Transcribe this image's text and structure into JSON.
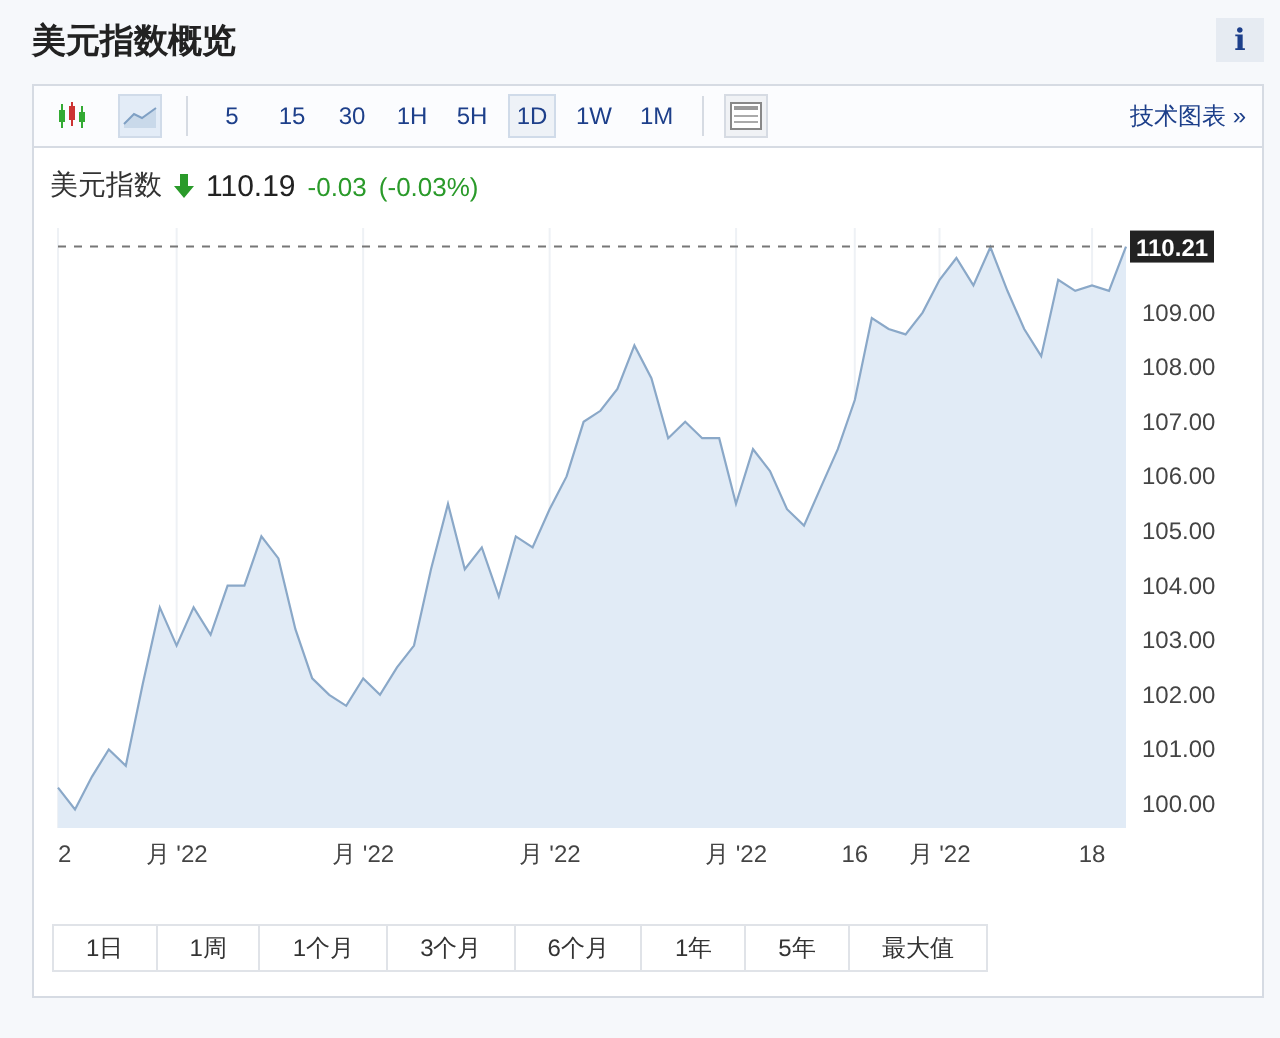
{
  "title": "美元指数概览",
  "info_button": "i",
  "toolbar": {
    "chart_types": [
      {
        "kind": "candlestick",
        "selected": false
      },
      {
        "kind": "area",
        "selected": true
      }
    ],
    "intervals": [
      {
        "label": "5",
        "selected": false
      },
      {
        "label": "15",
        "selected": false
      },
      {
        "label": "30",
        "selected": false
      },
      {
        "label": "1H",
        "selected": false
      },
      {
        "label": "5H",
        "selected": false
      },
      {
        "label": "1D",
        "selected": true
      },
      {
        "label": "1W",
        "selected": false
      },
      {
        "label": "1M",
        "selected": false
      }
    ],
    "technical_link": "技术图表 »"
  },
  "quote": {
    "name": "美元指数",
    "price": "110.19",
    "change": "-0.03",
    "change_percent": "(-0.03%)"
  },
  "chart_data": {
    "type": "area",
    "grid": true,
    "ylim": [
      99.56,
      110.55
    ],
    "categories": [
      "2",
      null,
      null,
      null,
      null,
      null,
      null,
      "月 '22",
      null,
      null,
      null,
      null,
      null,
      null,
      null,
      null,
      null,
      null,
      "月 '22",
      null,
      null,
      null,
      null,
      null,
      null,
      null,
      null,
      null,
      null,
      "月 '22",
      null,
      null,
      null,
      null,
      null,
      null,
      null,
      null,
      null,
      null,
      "月 '22",
      null,
      null,
      null,
      null,
      null,
      null,
      "16",
      null,
      null,
      null,
      null,
      "月 '22",
      null,
      null,
      null,
      null,
      null,
      null,
      null,
      null,
      "18",
      null,
      null
    ],
    "yticks": [
      {
        "value": 100,
        "label": "100.00"
      },
      {
        "value": 101,
        "label": "101.00"
      },
      {
        "value": 102,
        "label": "102.00"
      },
      {
        "value": 103,
        "label": "103.00"
      },
      {
        "value": 104,
        "label": "104.00"
      },
      {
        "value": 105,
        "label": "105.00"
      },
      {
        "value": 106,
        "label": "106.00"
      },
      {
        "value": 107,
        "label": "107.00"
      },
      {
        "value": 108,
        "label": "108.00"
      },
      {
        "value": 109,
        "label": "109.00"
      }
    ],
    "series": [
      {
        "color": "#8aa8c8",
        "values": [
          100.3,
          99.9,
          100.5,
          101.0,
          100.7,
          102.2,
          103.6,
          102.9,
          103.6,
          103.1,
          104.0,
          104.0,
          104.9,
          104.5,
          103.2,
          102.3,
          102.0,
          101.8,
          102.3,
          102.0,
          102.5,
          102.9,
          104.3,
          105.5,
          104.3,
          104.7,
          103.8,
          104.9,
          104.7,
          105.4,
          106.0,
          107.0,
          107.2,
          107.6,
          108.4,
          107.8,
          106.7,
          107.0,
          106.7,
          106.7,
          105.5,
          106.5,
          106.1,
          105.4,
          105.1,
          105.8,
          106.5,
          107.4,
          108.9,
          108.7,
          108.6,
          109.0,
          109.6,
          110.0,
          109.5,
          110.2,
          109.4,
          108.7,
          108.2,
          109.6,
          109.4,
          109.5,
          109.4,
          110.21
        ]
      }
    ],
    "ref_lines": [
      {
        "axis": "y",
        "value": 110.21,
        "label": "110.21"
      }
    ]
  },
  "ranges": [
    {
      "label": "1日",
      "selected": false
    },
    {
      "label": "1周",
      "selected": false
    },
    {
      "label": "1个月",
      "selected": false
    },
    {
      "label": "3个月",
      "selected": false
    },
    {
      "label": "6个月",
      "selected": false
    },
    {
      "label": "1年",
      "selected": false
    },
    {
      "label": "5年",
      "selected": false
    },
    {
      "label": "最大值",
      "selected": false
    }
  ]
}
